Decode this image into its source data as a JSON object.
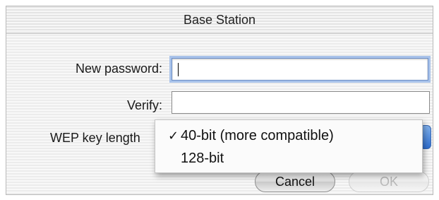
{
  "window": {
    "title": "Base Station"
  },
  "form": {
    "new_password_label": "New password:",
    "new_password_value": "",
    "verify_label": "Verify:",
    "verify_value": "",
    "wep_label": "WEP key length"
  },
  "wep_menu": {
    "items": [
      {
        "label": "40-bit (more compatible)",
        "checked": true,
        "check_glyph": "✓"
      },
      {
        "label": "128-bit",
        "checked": false,
        "check_glyph": ""
      }
    ]
  },
  "buttons": {
    "cancel": "Cancel",
    "ok": "OK"
  },
  "colors": {
    "focus_ring": "#a9c3ea",
    "popup_accent": "#2f6fd0"
  }
}
